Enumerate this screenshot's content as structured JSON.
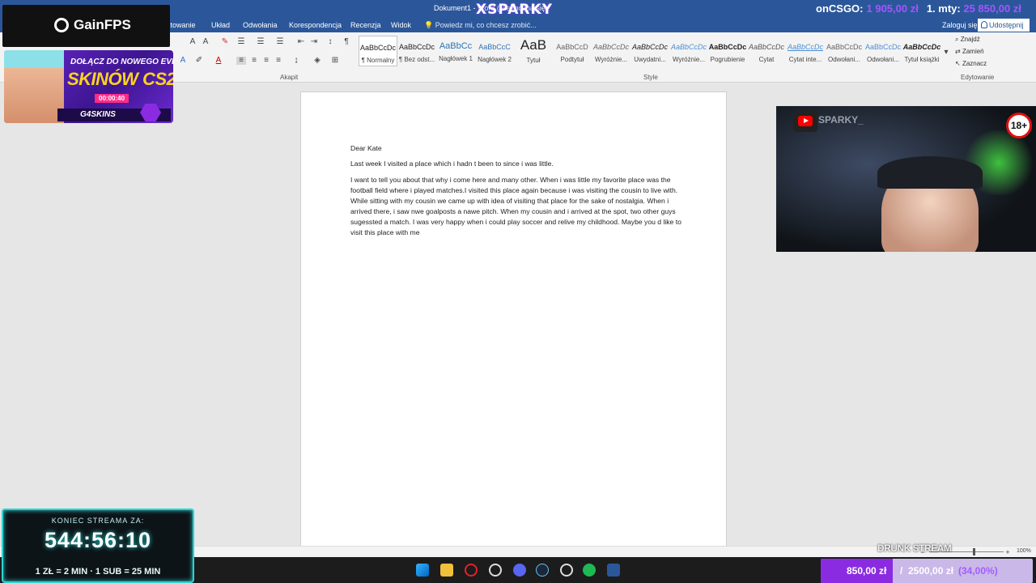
{
  "window": {
    "doc_title": "Dokument1 - Word (Nie można się)",
    "brand_overlay": "XSPARKY",
    "counter_label": "onCSGO:",
    "counter_value": "1 905,00 zł",
    "counter_label2": "1. mty:",
    "counter_value2": "25 850,00 zł"
  },
  "menu": {
    "tabs": [
      "ktowanie",
      "Układ",
      "Odwołania",
      "Korespondencja",
      "Recenzja",
      "Widok"
    ],
    "tell_me": "Powiedz mi, co chcesz zrobić...",
    "sign_in": "Zaloguj się",
    "share": "Udostępnij"
  },
  "ribbon": {
    "groups": [
      "Akapit",
      "Style",
      "Edytowanie"
    ],
    "styles": [
      {
        "preview": "AaBbCcDc",
        "name": "¶ Normalny"
      },
      {
        "preview": "AaBbCcDc",
        "name": "¶ Bez odst..."
      },
      {
        "preview": "AaBbCc",
        "name": "Nagłówek 1"
      },
      {
        "preview": "AaBbCcC",
        "name": "Nagłówek 2"
      },
      {
        "preview": "AaB",
        "name": "Tytuł"
      },
      {
        "preview": "AaBbCcD",
        "name": "Podtytuł"
      },
      {
        "preview": "AaBbCcDc",
        "name": "Wyróżnie..."
      },
      {
        "preview": "AaBbCcDc",
        "name": "Uwydatni..."
      },
      {
        "preview": "AaBbCcDc",
        "name": "Wyróżnie..."
      },
      {
        "preview": "AaBbCcDc",
        "name": "Pogrubienie"
      },
      {
        "preview": "AaBbCcDc",
        "name": "Cytat"
      },
      {
        "preview": "AaBbCcDc",
        "name": "Cytat inte..."
      },
      {
        "preview": "AaBbCcDc",
        "name": "Odwołani..."
      },
      {
        "preview": "AaBbCcDc",
        "name": "Odwołani..."
      },
      {
        "preview": "AaBbCcDc",
        "name": "Tytuł książki"
      }
    ],
    "editing": {
      "find": "Znajdź",
      "replace": "Zamień",
      "select": "Zaznacz"
    }
  },
  "document": {
    "greeting": "Dear Kate",
    "p1": "Last week I visited a place which i hadn t been to since i was little.",
    "p2": "I want to tell you about that why i come here and many other. When i was little my favorite place was the football field where i played matches.I visited this place again because i was visiting the cousin to live with. While sitting with my cousin we came up with idea of visiting that place for the sake of nostalgia. When i arrived there, i saw nwe goalposts a nawe pitch. When my cousin and i arrived at the spot, two other guys sugessted a match. I was very happy when i could play soccer and relive my childhood. Maybe you d like to visit this place with me"
  },
  "status": {
    "zoom": "100%"
  },
  "overlays": {
    "gainfps": "GainFPS",
    "ad_line1": "DOŁĄCZ DO NOWEGO EVENTU",
    "ad_line2": "SKINÓW CS2!",
    "ad_timer": "00:00:40",
    "ad_brand": "G4SKINS",
    "webcam_name": "SPARKY_",
    "age_badge": "18+",
    "countdown_title": "KONIEC STREAMA ZA:",
    "countdown_time": "544:56:10",
    "countdown_rules": "1 ZŁ = 2 MIN · 1 SUB = 25 MIN",
    "drunk_label": "DRUNK STREAM",
    "goal_current": "850,00 zł",
    "goal_sep": "/",
    "goal_target": "2500,00 zł",
    "goal_percent": "(34,00%)",
    "goal_fraction": 0.34
  },
  "taskbar": {
    "icons": [
      "windows-start-icon",
      "file-explorer-icon",
      "opera-icon",
      "settings-icon",
      "discord-icon",
      "steam-icon",
      "steelseries-icon",
      "spotify-icon",
      "word-icon"
    ]
  },
  "colors": {
    "word_blue": "#2b579a",
    "accent_purple": "#8a2be2",
    "cyan": "#2ad4d4"
  }
}
